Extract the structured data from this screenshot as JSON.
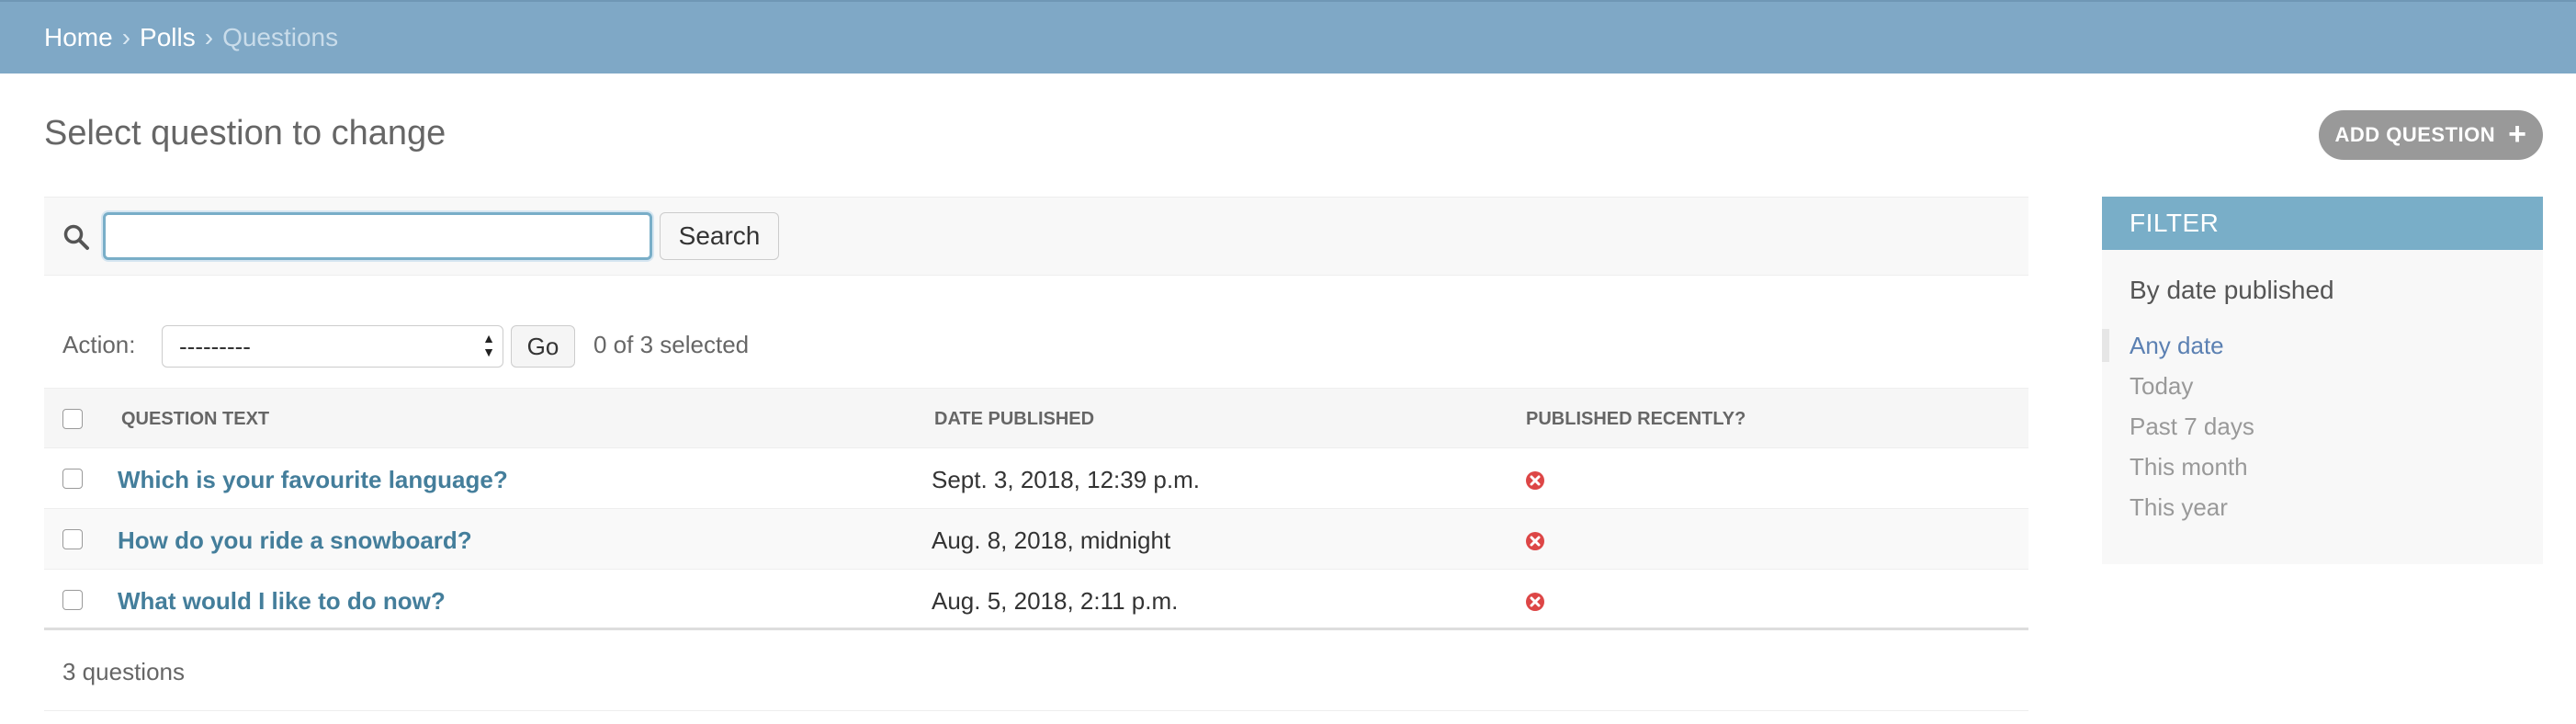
{
  "breadcrumbs": {
    "items": [
      "Home",
      "Polls",
      "Questions"
    ],
    "separator": "›"
  },
  "title": "Select question to change",
  "add_button": {
    "label": "ADD QUESTION",
    "icon": "plus-icon"
  },
  "search": {
    "value": "",
    "button_label": "Search",
    "icon": "search-icon"
  },
  "actions": {
    "label": "Action:",
    "selected_option": "---------",
    "go_label": "Go",
    "selected_count": "0 of 3 selected"
  },
  "table": {
    "columns": [
      "QUESTION TEXT",
      "DATE PUBLISHED",
      "PUBLISHED RECENTLY?"
    ],
    "rows": [
      {
        "question": "Which is your favourite language?",
        "date": "Sept. 3, 2018, 12:39 p.m.",
        "published_recently": false
      },
      {
        "question": "How do you ride a snowboard?",
        "date": "Aug. 8, 2018, midnight",
        "published_recently": false
      },
      {
        "question": "What would I like to do now?",
        "date": "Aug. 5, 2018, 2:11 p.m.",
        "published_recently": false
      }
    ]
  },
  "paginator": {
    "text": "3 questions"
  },
  "filter": {
    "title": "FILTER",
    "subtitle": "By date published",
    "options": [
      "Any date",
      "Today",
      "Past 7 days",
      "This month",
      "This year"
    ],
    "selected": "Any date"
  },
  "colors": {
    "header_bar": "#7fa8c6",
    "link": "#447e9b",
    "filter_header": "#79aec8",
    "status_false": "#dd4646"
  }
}
